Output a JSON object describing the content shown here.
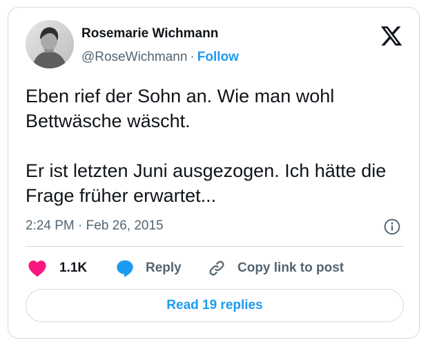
{
  "author": {
    "name": "Rosemarie Wichmann",
    "handle": "@RoseWichmann",
    "separator": "·",
    "follow_label": "Follow",
    "avatar_icon": "profile-photo"
  },
  "brand": {
    "logo_icon": "x-logo-icon"
  },
  "tweet": {
    "paragraphs": [
      "Eben rief der Sohn an. Wie man wohl Bettwäsche wäscht.",
      "Er ist letzten Juni ausgezogen. Ich hätte die Frage früher erwartet..."
    ],
    "timestamp": "2:24 PM · Feb 26, 2015",
    "info_icon": "info-icon"
  },
  "actions": {
    "likes_count": "1.1K",
    "reply_label": "Reply",
    "copy_link_label": "Copy link to post",
    "read_replies_label": "Read 19 replies"
  },
  "colors": {
    "text": "#0f1419",
    "secondary_text": "#536471",
    "accent_blue": "#1d9bf0",
    "like_pink": "#f91880",
    "border": "#cfd9de"
  }
}
